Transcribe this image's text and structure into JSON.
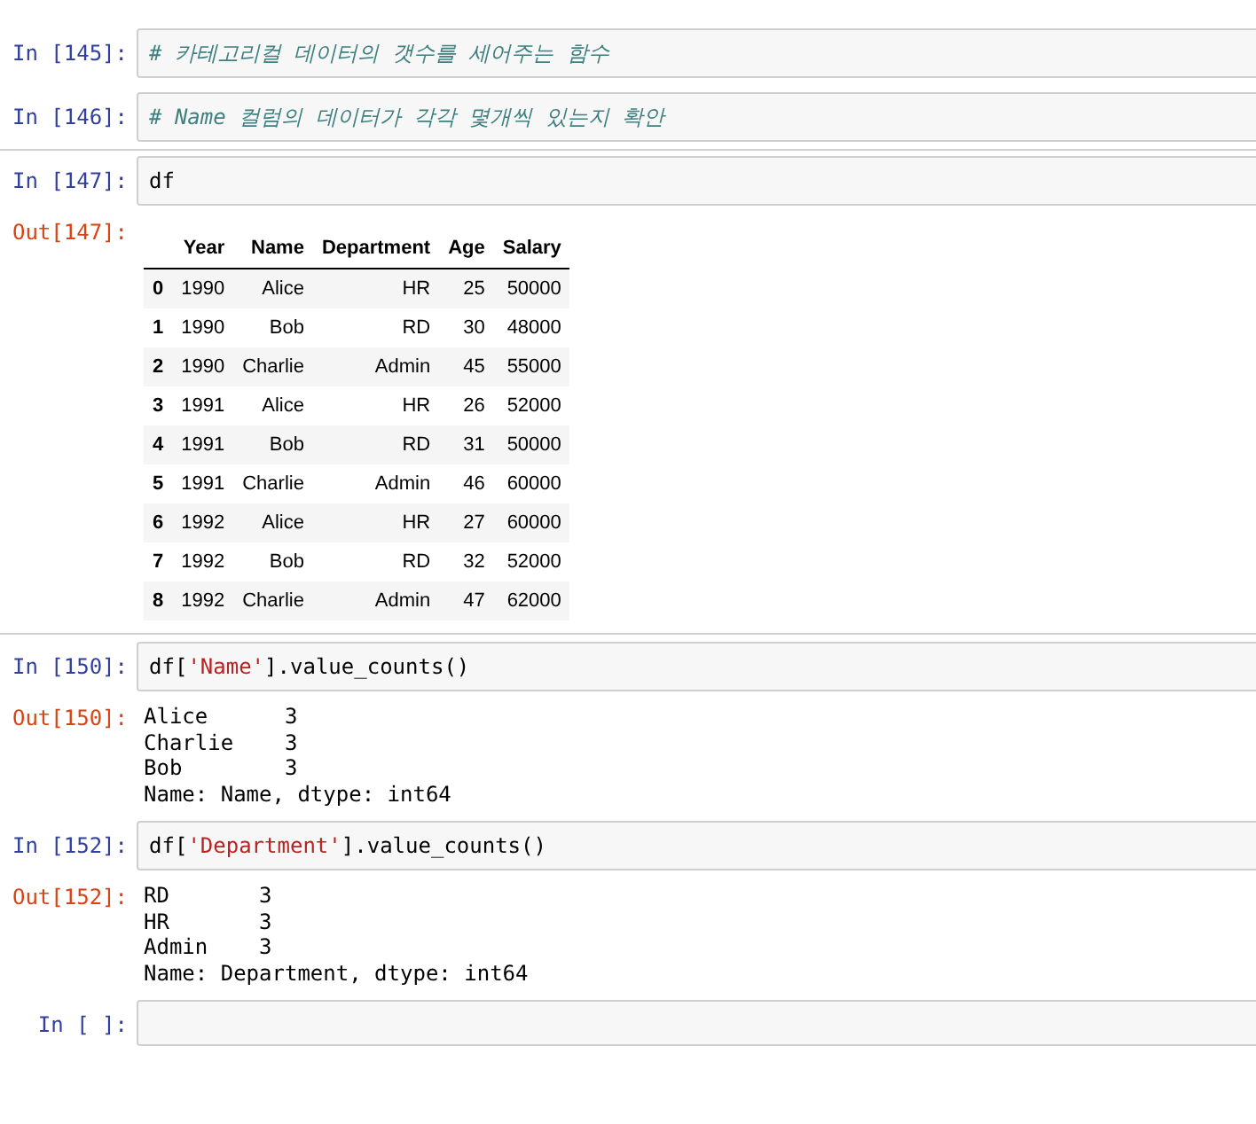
{
  "cells": [
    {
      "prompt": "In [145]:",
      "selected": false,
      "code": [
        {
          "kind": "comment",
          "text": "# 카테고리컬 데이터의 갯수를 세어주는 함수"
        }
      ]
    },
    {
      "prompt": "In [146]:",
      "selected": false,
      "code": [
        {
          "kind": "comment",
          "text": "# Name 컬럼의 데이터가 각각 몇개씩 있는지 확안"
        }
      ]
    },
    {
      "prompt": "In [147]:",
      "selected": true,
      "code": [
        {
          "kind": "plain",
          "text": "df"
        }
      ],
      "output": {
        "prompt": "Out[147]:",
        "kind": "table",
        "columns": [
          "",
          "Year",
          "Name",
          "Department",
          "Age",
          "Salary"
        ],
        "rows": [
          [
            "0",
            "1990",
            "Alice",
            "HR",
            "25",
            "50000"
          ],
          [
            "1",
            "1990",
            "Bob",
            "RD",
            "30",
            "48000"
          ],
          [
            "2",
            "1990",
            "Charlie",
            "Admin",
            "45",
            "55000"
          ],
          [
            "3",
            "1991",
            "Alice",
            "HR",
            "26",
            "52000"
          ],
          [
            "4",
            "1991",
            "Bob",
            "RD",
            "31",
            "50000"
          ],
          [
            "5",
            "1991",
            "Charlie",
            "Admin",
            "46",
            "60000"
          ],
          [
            "6",
            "1992",
            "Alice",
            "HR",
            "27",
            "60000"
          ],
          [
            "7",
            "1992",
            "Bob",
            "RD",
            "32",
            "52000"
          ],
          [
            "8",
            "1992",
            "Charlie",
            "Admin",
            "47",
            "62000"
          ]
        ]
      }
    },
    {
      "prompt": "In [150]:",
      "selected": false,
      "code": [
        {
          "kind": "plain",
          "text": "df["
        },
        {
          "kind": "string",
          "text": "'Name'"
        },
        {
          "kind": "plain",
          "text": "].value_counts()"
        }
      ],
      "output": {
        "prompt": "Out[150]:",
        "kind": "text",
        "lines": [
          "Alice      3",
          "Charlie    3",
          "Bob        3",
          "Name: Name, dtype: int64"
        ]
      }
    },
    {
      "prompt": "In [152]:",
      "selected": false,
      "code": [
        {
          "kind": "plain",
          "text": "df["
        },
        {
          "kind": "string",
          "text": "'Department'"
        },
        {
          "kind": "plain",
          "text": "].value_counts()"
        }
      ],
      "output": {
        "prompt": "Out[152]:",
        "kind": "text",
        "lines": [
          "RD       3",
          "HR       3",
          "Admin    3",
          "Name: Department, dtype: int64"
        ]
      }
    },
    {
      "prompt": "In [ ]:",
      "selected": false
    }
  ]
}
